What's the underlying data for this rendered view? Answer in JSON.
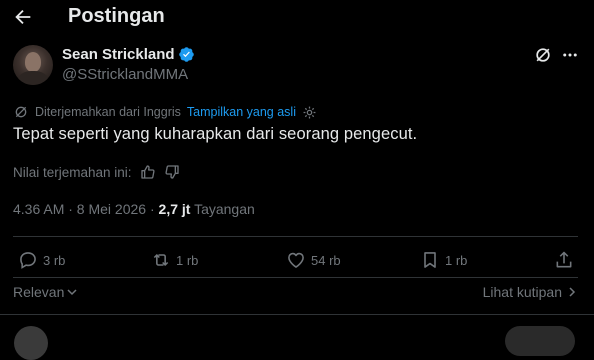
{
  "header": {
    "title": "Postingan",
    "back_icon": "arrow-left-icon"
  },
  "post": {
    "display_name": "Sean Strickland",
    "handle": "@SStricklandMMA",
    "verified_color": "#1d9bf0",
    "translation_notice": "Diterjemahkan dari Inggris",
    "show_original": "Tampilkan yang asli",
    "text": "Tepat seperti yang kuharapkan dari seorang pengecut.",
    "rate_label": "Nilai terjemahan ini:",
    "time": "4.36 AM · 8 Mei 2026 ·",
    "views_count": "2,7 jt",
    "views_label": "Tayangan"
  },
  "actions": {
    "replies": "3 rb",
    "reposts": "1 rb",
    "likes": "54 rb",
    "bookmarks": "1 rb"
  },
  "footer": {
    "sort_label": "Relevan",
    "quotes_label": "Lihat kutipan"
  },
  "colors": {
    "background": "#000000",
    "text": "#e7e9ea",
    "muted": "#71767b",
    "accent": "#1d9bf0",
    "divider": "#2f3336"
  }
}
